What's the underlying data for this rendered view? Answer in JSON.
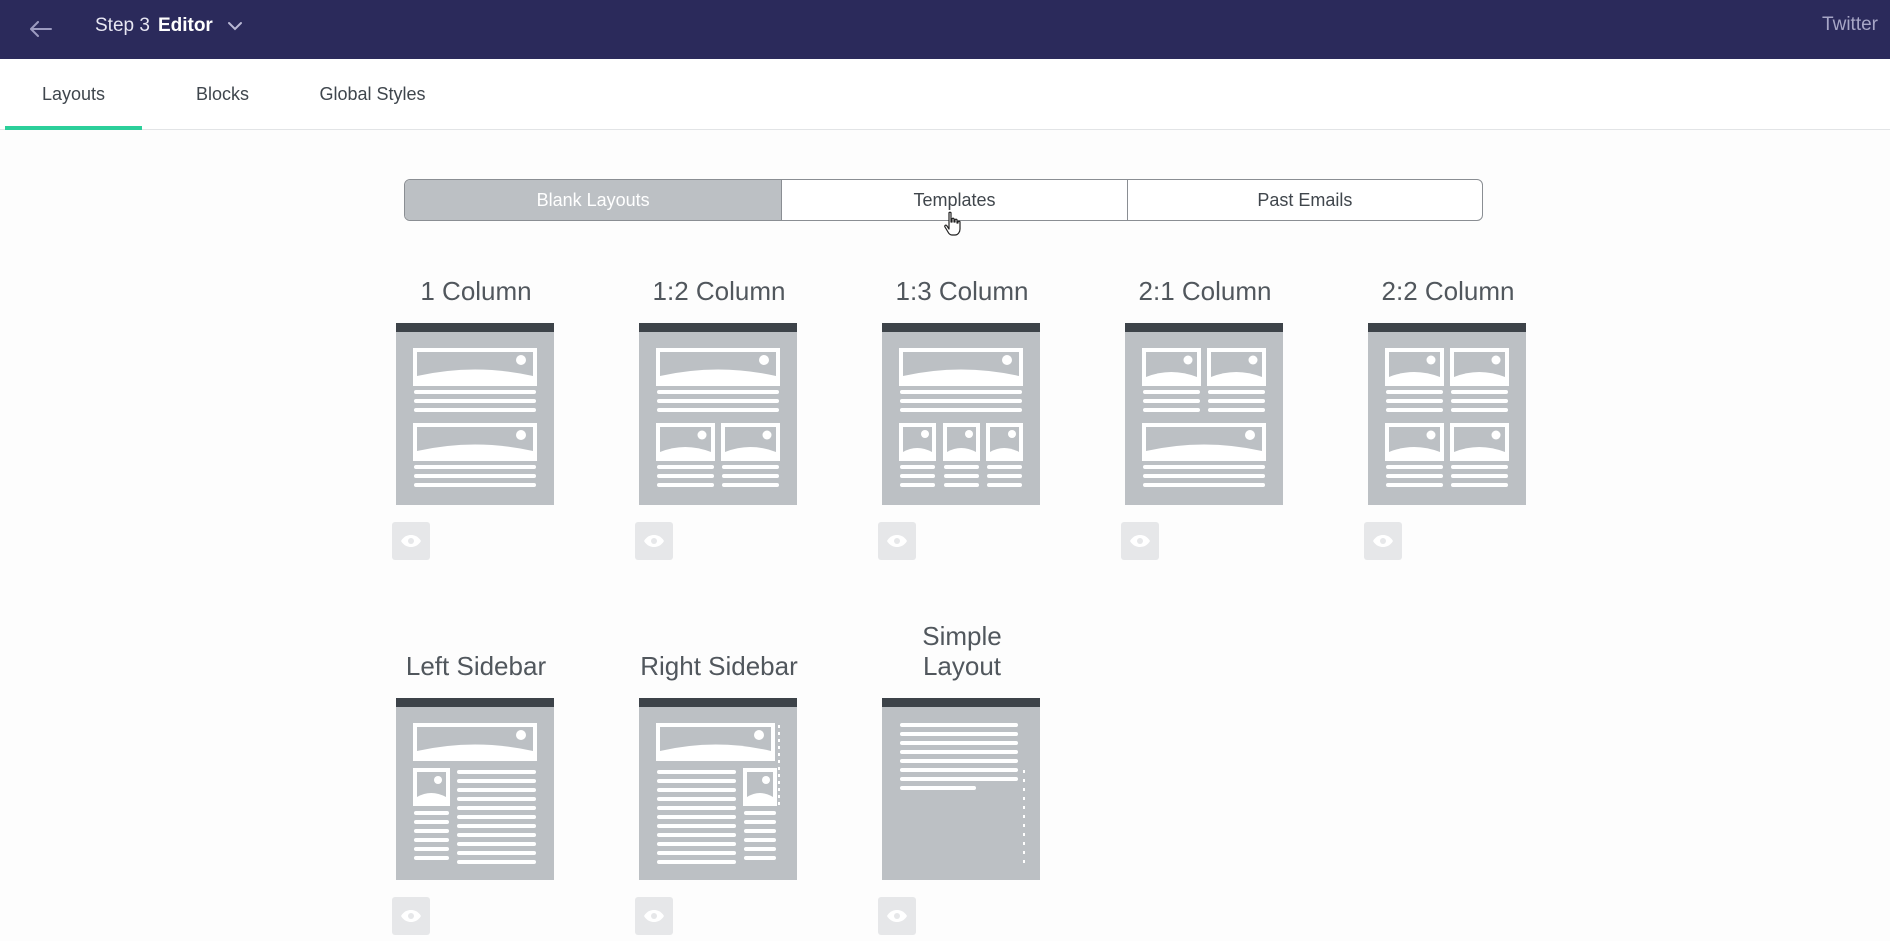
{
  "header": {
    "step_label": "Step 3",
    "step_name": "Editor",
    "right_text": "Twitter"
  },
  "tabs": [
    {
      "label": "Layouts",
      "active": true
    },
    {
      "label": "Blocks",
      "active": false
    },
    {
      "label": "Global Styles",
      "active": false
    }
  ],
  "segmented": [
    {
      "label": "Blank Layouts",
      "active": true
    },
    {
      "label": "Templates",
      "active": false
    },
    {
      "label": "Past Emails",
      "active": false
    }
  ],
  "layouts": [
    {
      "title": "1 Column",
      "icon": "one-column-layout-icon"
    },
    {
      "title": "1:2 Column",
      "icon": "one-two-column-layout-icon"
    },
    {
      "title": "1:3 Column",
      "icon": "one-three-column-layout-icon"
    },
    {
      "title": "2:1 Column",
      "icon": "two-one-column-layout-icon"
    },
    {
      "title": "2:2 Column",
      "icon": "two-two-column-layout-icon"
    },
    {
      "title": "Left Sidebar",
      "icon": "left-sidebar-layout-icon"
    },
    {
      "title": "Right Sidebar",
      "icon": "right-sidebar-layout-icon"
    },
    {
      "title": "Simple Layout",
      "icon": "simple-layout-icon"
    }
  ],
  "colors": {
    "topbar": "#2b2a5b",
    "accent": "#2ccf9a",
    "thumb_bg": "#bcc0c4",
    "thumb_top": "#3d4349"
  }
}
